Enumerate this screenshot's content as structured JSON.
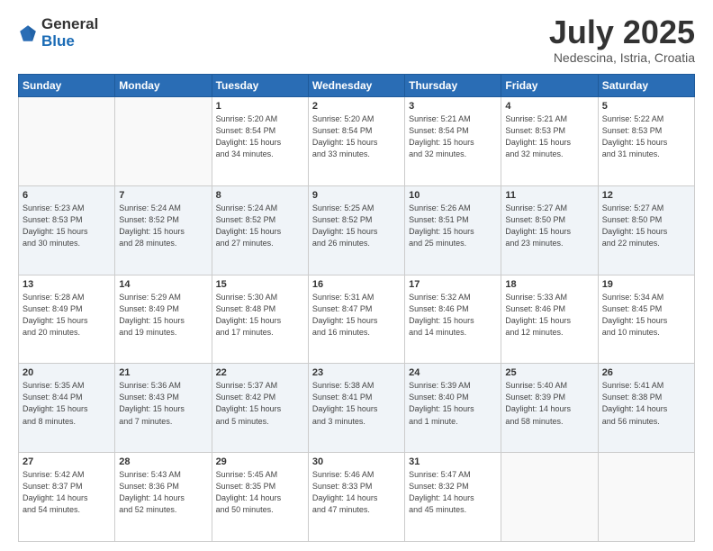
{
  "header": {
    "logo_general": "General",
    "logo_blue": "Blue",
    "month_title": "July 2025",
    "location": "Nedescina, Istria, Croatia"
  },
  "days_of_week": [
    "Sunday",
    "Monday",
    "Tuesday",
    "Wednesday",
    "Thursday",
    "Friday",
    "Saturday"
  ],
  "weeks": [
    {
      "shade": "white",
      "days": [
        {
          "num": "",
          "info": ""
        },
        {
          "num": "",
          "info": ""
        },
        {
          "num": "1",
          "info": "Sunrise: 5:20 AM\nSunset: 8:54 PM\nDaylight: 15 hours\nand 34 minutes."
        },
        {
          "num": "2",
          "info": "Sunrise: 5:20 AM\nSunset: 8:54 PM\nDaylight: 15 hours\nand 33 minutes."
        },
        {
          "num": "3",
          "info": "Sunrise: 5:21 AM\nSunset: 8:54 PM\nDaylight: 15 hours\nand 32 minutes."
        },
        {
          "num": "4",
          "info": "Sunrise: 5:21 AM\nSunset: 8:53 PM\nDaylight: 15 hours\nand 32 minutes."
        },
        {
          "num": "5",
          "info": "Sunrise: 5:22 AM\nSunset: 8:53 PM\nDaylight: 15 hours\nand 31 minutes."
        }
      ]
    },
    {
      "shade": "shade",
      "days": [
        {
          "num": "6",
          "info": "Sunrise: 5:23 AM\nSunset: 8:53 PM\nDaylight: 15 hours\nand 30 minutes."
        },
        {
          "num": "7",
          "info": "Sunrise: 5:24 AM\nSunset: 8:52 PM\nDaylight: 15 hours\nand 28 minutes."
        },
        {
          "num": "8",
          "info": "Sunrise: 5:24 AM\nSunset: 8:52 PM\nDaylight: 15 hours\nand 27 minutes."
        },
        {
          "num": "9",
          "info": "Sunrise: 5:25 AM\nSunset: 8:52 PM\nDaylight: 15 hours\nand 26 minutes."
        },
        {
          "num": "10",
          "info": "Sunrise: 5:26 AM\nSunset: 8:51 PM\nDaylight: 15 hours\nand 25 minutes."
        },
        {
          "num": "11",
          "info": "Sunrise: 5:27 AM\nSunset: 8:50 PM\nDaylight: 15 hours\nand 23 minutes."
        },
        {
          "num": "12",
          "info": "Sunrise: 5:27 AM\nSunset: 8:50 PM\nDaylight: 15 hours\nand 22 minutes."
        }
      ]
    },
    {
      "shade": "white",
      "days": [
        {
          "num": "13",
          "info": "Sunrise: 5:28 AM\nSunset: 8:49 PM\nDaylight: 15 hours\nand 20 minutes."
        },
        {
          "num": "14",
          "info": "Sunrise: 5:29 AM\nSunset: 8:49 PM\nDaylight: 15 hours\nand 19 minutes."
        },
        {
          "num": "15",
          "info": "Sunrise: 5:30 AM\nSunset: 8:48 PM\nDaylight: 15 hours\nand 17 minutes."
        },
        {
          "num": "16",
          "info": "Sunrise: 5:31 AM\nSunset: 8:47 PM\nDaylight: 15 hours\nand 16 minutes."
        },
        {
          "num": "17",
          "info": "Sunrise: 5:32 AM\nSunset: 8:46 PM\nDaylight: 15 hours\nand 14 minutes."
        },
        {
          "num": "18",
          "info": "Sunrise: 5:33 AM\nSunset: 8:46 PM\nDaylight: 15 hours\nand 12 minutes."
        },
        {
          "num": "19",
          "info": "Sunrise: 5:34 AM\nSunset: 8:45 PM\nDaylight: 15 hours\nand 10 minutes."
        }
      ]
    },
    {
      "shade": "shade",
      "days": [
        {
          "num": "20",
          "info": "Sunrise: 5:35 AM\nSunset: 8:44 PM\nDaylight: 15 hours\nand 8 minutes."
        },
        {
          "num": "21",
          "info": "Sunrise: 5:36 AM\nSunset: 8:43 PM\nDaylight: 15 hours\nand 7 minutes."
        },
        {
          "num": "22",
          "info": "Sunrise: 5:37 AM\nSunset: 8:42 PM\nDaylight: 15 hours\nand 5 minutes."
        },
        {
          "num": "23",
          "info": "Sunrise: 5:38 AM\nSunset: 8:41 PM\nDaylight: 15 hours\nand 3 minutes."
        },
        {
          "num": "24",
          "info": "Sunrise: 5:39 AM\nSunset: 8:40 PM\nDaylight: 15 hours\nand 1 minute."
        },
        {
          "num": "25",
          "info": "Sunrise: 5:40 AM\nSunset: 8:39 PM\nDaylight: 14 hours\nand 58 minutes."
        },
        {
          "num": "26",
          "info": "Sunrise: 5:41 AM\nSunset: 8:38 PM\nDaylight: 14 hours\nand 56 minutes."
        }
      ]
    },
    {
      "shade": "white",
      "days": [
        {
          "num": "27",
          "info": "Sunrise: 5:42 AM\nSunset: 8:37 PM\nDaylight: 14 hours\nand 54 minutes."
        },
        {
          "num": "28",
          "info": "Sunrise: 5:43 AM\nSunset: 8:36 PM\nDaylight: 14 hours\nand 52 minutes."
        },
        {
          "num": "29",
          "info": "Sunrise: 5:45 AM\nSunset: 8:35 PM\nDaylight: 14 hours\nand 50 minutes."
        },
        {
          "num": "30",
          "info": "Sunrise: 5:46 AM\nSunset: 8:33 PM\nDaylight: 14 hours\nand 47 minutes."
        },
        {
          "num": "31",
          "info": "Sunrise: 5:47 AM\nSunset: 8:32 PM\nDaylight: 14 hours\nand 45 minutes."
        },
        {
          "num": "",
          "info": ""
        },
        {
          "num": "",
          "info": ""
        }
      ]
    }
  ]
}
